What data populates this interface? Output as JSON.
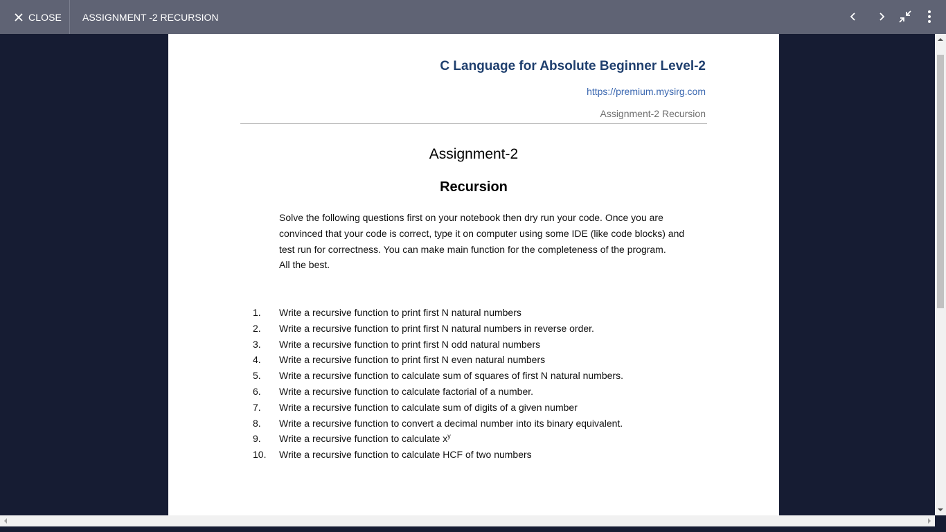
{
  "toolbar": {
    "close_label": "CLOSE",
    "close_icon": "close-icon",
    "title": "ASSIGNMENT -2 RECURSION",
    "icons": [
      "chevron-left-icon",
      "chevron-right-icon",
      "exit-fullscreen-icon",
      "more-vert-icon"
    ]
  },
  "document": {
    "header": {
      "title": "C Language for Absolute Beginner Level-2",
      "url": "https://premium.mysirg.com",
      "subtitle": "Assignment-2 Recursion"
    },
    "heading": "Assignment-2",
    "subheading": "Recursion",
    "intro": "Solve the following questions first on your notebook then dry run your code. Once you are convinced that your code is correct, type it on computer using some IDE (like code blocks) and test run for correctness. You can make main function for the completeness of the program.",
    "closing": "All the best.",
    "questions": [
      {
        "num": "1.",
        "text": "Write a recursive function to print first N natural numbers"
      },
      {
        "num": "2.",
        "text": "Write a recursive function to print first N natural numbers in reverse order."
      },
      {
        "num": "3.",
        "text": "Write a recursive function to print first N odd natural numbers"
      },
      {
        "num": "4.",
        "text": "Write a recursive function to print first N even natural numbers"
      },
      {
        "num": "5.",
        "text": "Write a recursive function to calculate sum of squares of first N natural numbers."
      },
      {
        "num": "6.",
        "text": "Write a recursive function to calculate factorial of a number."
      },
      {
        "num": "7.",
        "text": "Write a recursive function to calculate sum of digits of a given number"
      },
      {
        "num": "8.",
        "text": "Write a recursive function to convert a decimal number into its binary equivalent."
      },
      {
        "num": "9.",
        "text": "Write a recursive function to calculate x",
        "sup": "y"
      },
      {
        "num": "10.",
        "text": "Write a recursive function to calculate HCF of two numbers"
      }
    ]
  },
  "colors": {
    "toolbar_bg": "#5f6374",
    "viewer_bg": "#161c33",
    "header_title": "#1f3f6e",
    "header_url": "#3a67b0"
  }
}
